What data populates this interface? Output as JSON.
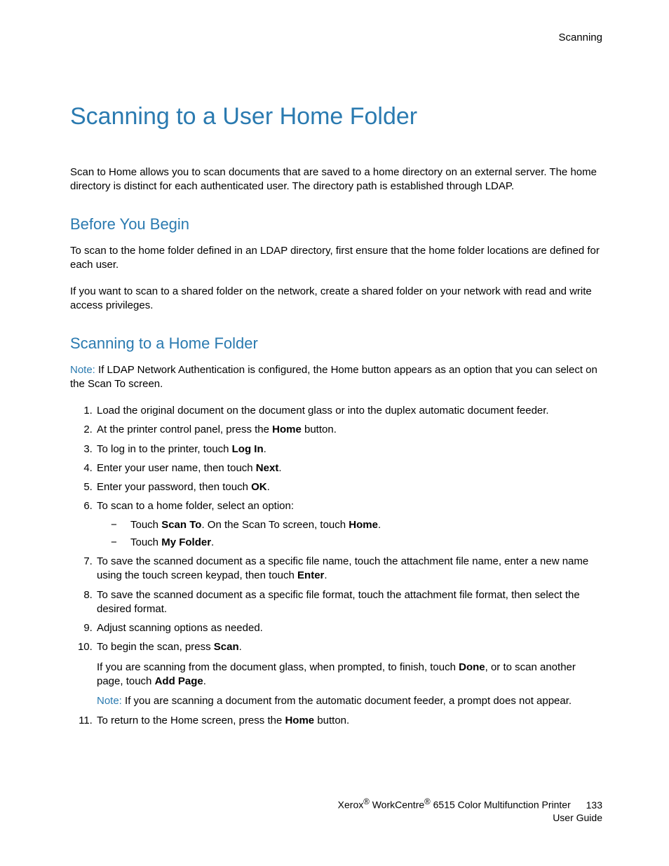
{
  "header": {
    "section": "Scanning"
  },
  "title": "Scanning to a User Home Folder",
  "intro": "Scan to Home allows you to scan documents that are saved to a home directory on an external server. The home directory is distinct for each authenticated user. The directory path is established through LDAP.",
  "section1": {
    "heading": "Before You Begin",
    "p1": "To scan to the home folder defined in an LDAP directory, first ensure that the home folder locations are defined for each user.",
    "p2": "If you want to scan to a shared folder on the network, create a shared folder on your network with read and write access privileges."
  },
  "section2": {
    "heading": "Scanning to a Home Folder",
    "note_label": "Note:",
    "note_text": " If LDAP Network Authentication is configured, the Home button appears as an option that you can select on the Scan To screen.",
    "steps": {
      "s1": "Load the original document on the document glass or into the duplex automatic document feeder.",
      "s2a": "At the printer control panel, press the ",
      "s2b": "Home",
      "s2c": " button.",
      "s3a": "To log in to the printer, touch ",
      "s3b": "Log In",
      "s3c": ".",
      "s4a": "Enter your user name, then touch ",
      "s4b": "Next",
      "s4c": ".",
      "s5a": "Enter your password, then touch ",
      "s5b": "OK",
      "s5c": ".",
      "s6": "To scan to a home folder, select an option:",
      "s6d1a": "Touch ",
      "s6d1b": "Scan To",
      "s6d1c": ". On the Scan To screen, touch ",
      "s6d1d": "Home",
      "s6d1e": ".",
      "s6d2a": "Touch ",
      "s6d2b": "My Folder",
      "s6d2c": ".",
      "s7a": "To save the scanned document as a specific file name, touch the attachment file name, enter a new name using the touch screen keypad, then touch ",
      "s7b": "Enter",
      "s7c": ".",
      "s8": "To save the scanned document as a specific file format, touch the attachment file format, then select the desired format.",
      "s9": "Adjust scanning options as needed.",
      "s10a": "To begin the scan, press ",
      "s10b": "Scan",
      "s10c": ".",
      "s10_p1a": "If you are scanning from the document glass, when prompted, to finish, touch ",
      "s10_p1b": "Done",
      "s10_p1c": ", or to scan another page, touch ",
      "s10_p1d": "Add Page",
      "s10_p1e": ".",
      "s10_note_label": "Note:",
      "s10_note_text": " If you are scanning a document from the automatic document feeder, a prompt does not appear.",
      "s11a": "To return to the Home screen, press the ",
      "s11b": "Home",
      "s11c": " button."
    }
  },
  "footer": {
    "line1a": "Xerox",
    "line1b": " WorkCentre",
    "line1c": " 6515 Color Multifunction Printer",
    "page": "133",
    "line2": "User Guide",
    "reg": "®"
  }
}
